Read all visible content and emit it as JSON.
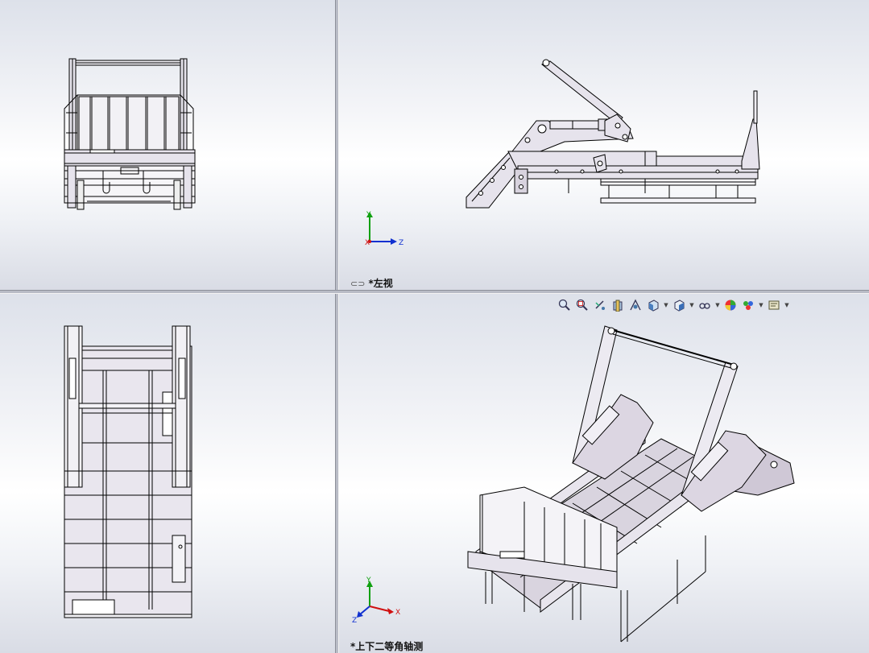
{
  "viewports": {
    "front": {
      "label": ""
    },
    "left": {
      "label": "*左视"
    },
    "top": {
      "label": ""
    },
    "iso": {
      "label": "*上下二等角轴测"
    }
  },
  "triad": {
    "x": "X",
    "y": "Y",
    "z": "Z"
  },
  "hud_toolbar": {
    "buttons": [
      {
        "icon": "zoom-to-fit-icon"
      },
      {
        "icon": "zoom-to-area-icon"
      },
      {
        "icon": "previous-view-icon"
      },
      {
        "icon": "section-view-icon"
      },
      {
        "icon": "dynamic-annotation-view-icon"
      },
      {
        "icon": "view-orientation-icon",
        "dropdown": true
      },
      {
        "icon": "display-style-icon",
        "dropdown": true
      },
      {
        "icon": "hide-show-items-icon",
        "dropdown": true
      },
      {
        "icon": "edit-appearance-icon"
      },
      {
        "icon": "apply-scene-icon",
        "dropdown": true
      },
      {
        "icon": "view-settings-icon",
        "dropdown": true
      }
    ]
  },
  "colors": {
    "model_fill": "#e6e3ec",
    "model_fill_dark": "#cfc8d6",
    "edge": "#000000",
    "axis_x": "#d01010",
    "axis_y": "#10a010",
    "axis_z": "#1030d0"
  }
}
